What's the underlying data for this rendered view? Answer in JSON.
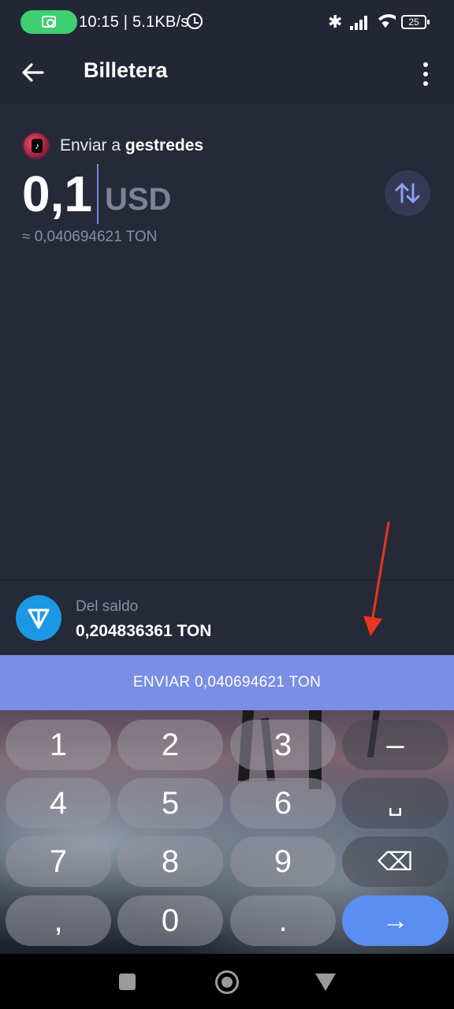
{
  "status_bar": {
    "text": "10:15 | 5.1KB/s",
    "battery": "25"
  },
  "header": {
    "title": "Billetera"
  },
  "send": {
    "recipient_prefix": "Enviar a ",
    "recipient_name": "gestredes",
    "amount": "0,1",
    "currency": "USD",
    "approx": "≈ 0,040694621 TON"
  },
  "balance": {
    "label": "Del saldo",
    "value": "0,204836361 TON"
  },
  "send_button": {
    "label": "ENVIAR 0,040694621 TON"
  },
  "keyboard": {
    "keys": [
      "1",
      "2",
      "3",
      "–",
      "4",
      "5",
      "6",
      "␣",
      "7",
      "8",
      "9",
      "⌫",
      ",",
      "0",
      ".",
      "→"
    ]
  },
  "colors": {
    "background": "#252938",
    "accent": "#7a8ee6",
    "ton_blue": "#1b98e3",
    "enter_key": "#5a8ef0",
    "annotation": "#e8361f"
  }
}
